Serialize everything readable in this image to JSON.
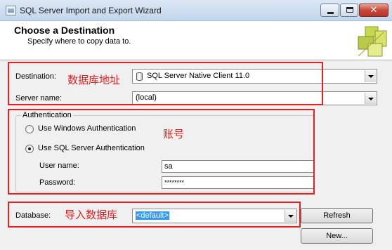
{
  "window": {
    "title": "SQL Server Import and Export Wizard"
  },
  "header": {
    "title": "Choose a Destination",
    "subtitle": "Specify where to copy data to."
  },
  "form": {
    "destination": {
      "label": "Destination:",
      "value": "SQL Server Native Client 11.0"
    },
    "server_name": {
      "label": "Server name:",
      "value": "(local)"
    },
    "authentication": {
      "legend": "Authentication",
      "windows_option": "Use Windows Authentication",
      "sql_option": "Use SQL Server Authentication",
      "selected": "sql",
      "username": {
        "label": "User name:",
        "value": "sa"
      },
      "password": {
        "label": "Password:",
        "value": "********"
      }
    },
    "database": {
      "label": "Database:",
      "value": "<default>"
    },
    "refresh_button": "Refresh",
    "new_button": "New..."
  },
  "annotations": {
    "destination_note": "数据库地址",
    "account_note": "账号",
    "database_note": "导入数据库",
    "color": "#e62020"
  }
}
